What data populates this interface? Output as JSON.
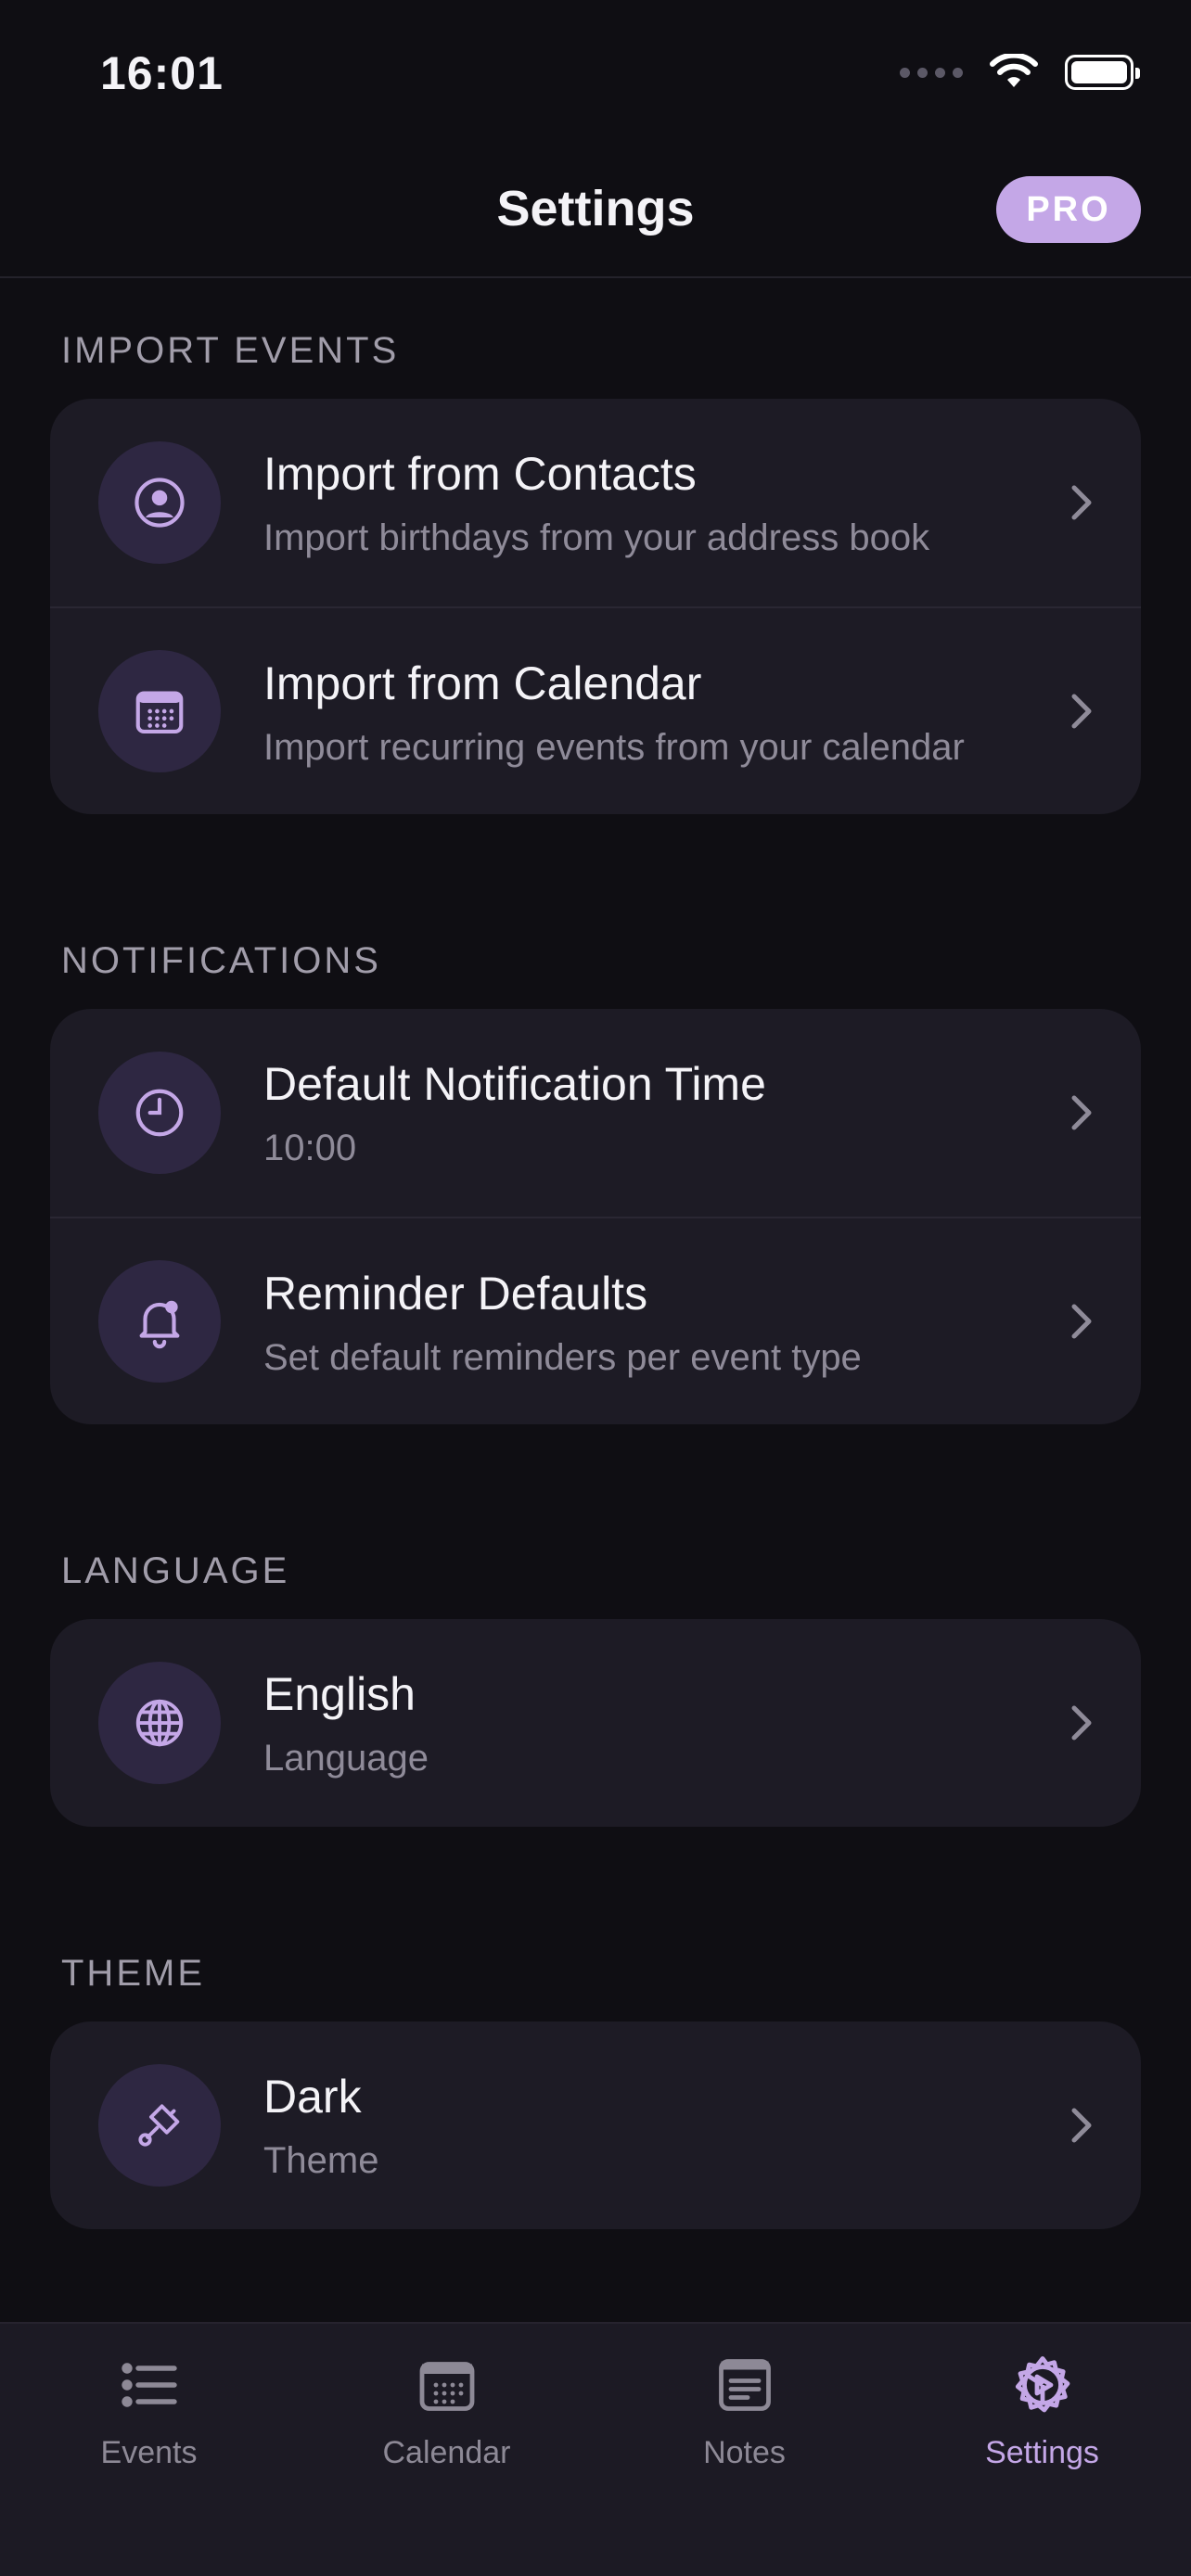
{
  "status_bar": {
    "time": "16:01"
  },
  "header": {
    "title": "Settings",
    "badge": "PRO"
  },
  "sections": [
    {
      "label": "IMPORT EVENTS",
      "items": [
        {
          "title": "Import from Contacts",
          "subtitle": "Import birthdays from your address book",
          "icon": "contact-icon"
        },
        {
          "title": "Import from Calendar",
          "subtitle": "Import recurring events from your calendar",
          "icon": "calendar-icon"
        }
      ]
    },
    {
      "label": "NOTIFICATIONS",
      "items": [
        {
          "title": "Default Notification Time",
          "subtitle": "10:00",
          "icon": "clock-icon"
        },
        {
          "title": "Reminder Defaults",
          "subtitle": "Set default reminders per event type",
          "icon": "bell-icon"
        }
      ]
    },
    {
      "label": "LANGUAGE",
      "items": [
        {
          "title": "English",
          "subtitle": "Language",
          "icon": "globe-icon"
        }
      ]
    },
    {
      "label": "THEME",
      "items": [
        {
          "title": "Dark",
          "subtitle": "Theme",
          "icon": "paintbrush-icon"
        }
      ]
    }
  ],
  "tabbar": {
    "tabs": [
      {
        "label": "Events",
        "icon": "list-icon",
        "active": false
      },
      {
        "label": "Calendar",
        "icon": "calendar-icon",
        "active": false
      },
      {
        "label": "Notes",
        "icon": "notes-icon",
        "active": false
      },
      {
        "label": "Settings",
        "icon": "gear-icon",
        "active": true
      }
    ]
  },
  "colors": {
    "background": "#0f0e13",
    "card": "#1d1b25",
    "accent": "#c4a7e7",
    "icon_background": "#2e2742",
    "muted_text": "#8f8b99"
  }
}
